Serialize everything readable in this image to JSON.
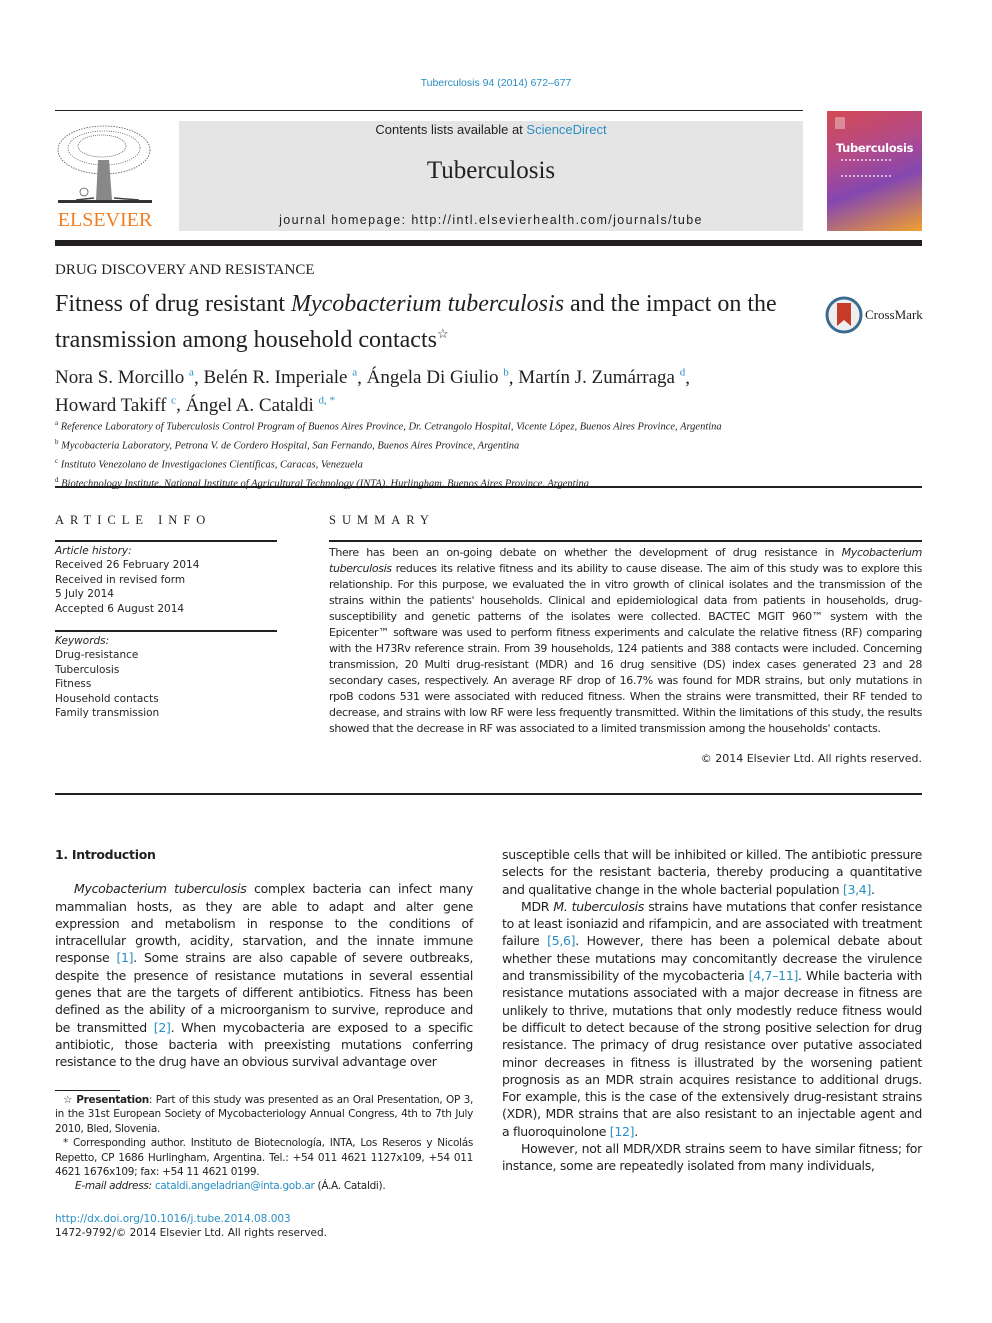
{
  "header": {
    "journal_ref": "Tuberculosis 94 (2014) 672–677",
    "contents_prefix": "Contents lists available at ",
    "contents_link": "ScienceDirect",
    "journal_name": "Tuberculosis",
    "homepage": "journal homepage: http://intl.elsevierhealth.com/journals/tube",
    "publisher_logo_text": "ELSEVIER",
    "cover_title": "Tuberculosis",
    "crossmark_label": "CrossMark"
  },
  "colors": {
    "link": "#2a8ec4",
    "elsevier_orange": "#f47d20",
    "masthead_bg": "#e5e5e5"
  },
  "article": {
    "section": "DRUG DISCOVERY AND RESISTANCE",
    "title_part1": "Fitness of drug resistant ",
    "title_italic": "Mycobacterium tuberculosis",
    "title_part2": " and the impact on the transmission among household contacts",
    "title_mark": "☆",
    "authors": [
      {
        "name": "Nora S. Morcillo",
        "sup": "a"
      },
      {
        "name": "Belén R. Imperiale",
        "sup": "a"
      },
      {
        "name": "Ángela Di Giulio",
        "sup": "b"
      },
      {
        "name": "Martín J. Zumárraga",
        "sup": "d"
      },
      {
        "name": "Howard Takiff",
        "sup": "c"
      },
      {
        "name": "Ángel A. Cataldi",
        "sup": "d, *"
      }
    ],
    "affiliations": [
      {
        "sup": "a",
        "text": "Reference Laboratory of Tuberculosis Control Program of Buenos Aires Province, Dr. Cetrangolo Hospital, Vicente López, Buenos Aires Province, Argentina"
      },
      {
        "sup": "b",
        "text": "Mycobacteria Laboratory, Petrona V. de Cordero Hospital, San Fernando, Buenos Aires Province, Argentina"
      },
      {
        "sup": "c",
        "text": "Instituto Venezolano de Investigaciones Científicas, Caracas, Venezuela"
      },
      {
        "sup": "d",
        "text": "Biotechnology Institute, National Institute of Agricultural Technology (INTA), Hurlingham, Buenos Aires Province, Argentina"
      }
    ]
  },
  "article_info": {
    "heading": "ARTICLE INFO",
    "history_label": "Article history:",
    "history": [
      "Received 26 February 2014",
      "Received in revised form",
      "5 July 2014",
      "Accepted 6 August 2014"
    ],
    "keywords_label": "Keywords:",
    "keywords": [
      "Drug-resistance",
      "Tuberculosis",
      "Fitness",
      "Household contacts",
      "Family transmission"
    ]
  },
  "summary": {
    "heading": "SUMMARY",
    "lead": "There has been an on-going debate on whether the development of drug resistance in ",
    "italic": "Mycobacterium tuberculosis",
    "body": " reduces its relative fitness and its ability to cause disease. The aim of this study was to explore this relationship. For this purpose, we evaluated the in vitro growth of clinical isolates and the transmission of the strains within the patients' households. Clinical and epidemiological data from patients in households, drug-susceptibility and genetic patterns of the isolates were collected. BACTEC MGIT 960™ system with the Epicenter™ software was used to perform fitness experiments and calculate the relative fitness (RF) comparing with the H73Rv reference strain. From 39 households, 124 patients and 388 contacts were included. Concerning transmission, 20 Multi drug-resistant (MDR) and 16 drug sensitive (DS) index cases generated 23 and 28 secondary cases, respectively. An average RF drop of 16.7% was found for MDR strains, but only mutations in rpoB codons 531 were associated with reduced fitness. When the strains were transmitted, their RF tended to decrease, and strains with low RF were less frequently transmitted. Within the limitations of this study, the results showed that the decrease in RF was associated to a limited transmission among the households' contacts.",
    "copyright": "© 2014 Elsevier Ltd. All rights reserved."
  },
  "intro": {
    "heading": "1.  Introduction",
    "p1_italic": "Mycobacterium tuberculosis",
    "p1_a": " complex bacteria can infect many mammalian hosts, as they are able to adapt and alter gene expression and metabolism in response to the conditions of intracellular growth, acidity, starvation, and the innate immune response ",
    "cite1": "[1]",
    "p1_b": ". Some strains are also capable of severe outbreaks, despite the presence of resistance mutations in several essential genes that are the targets of different antibiotics. Fitness has been defined as the ability of a microorganism to survive, reproduce and be transmitted ",
    "cite2": "[2]",
    "p1_c": ". When mycobacteria are exposed to a specific antibiotic, those bacteria with preexisting mutations conferring resistance to the drug have an obvious survival advantage over susceptible cells that will be inhibited or killed. The antibiotic pressure selects for the resistant bacteria, thereby producing a quantitative and qualitative change in the whole bacterial population ",
    "cite3": "[3,4]",
    "p1_d": ".",
    "p2_a": "MDR ",
    "p2_italic": "M. tuberculosis",
    "p2_b": " strains have mutations that confer resistance to at least isoniazid and rifampicin, and are associated with treatment failure ",
    "cite4": "[5,6]",
    "p2_c": ". However, there has been a polemical debate about whether these mutations may concomitantly decrease the virulence and transmissibility of the mycobacteria ",
    "cite5": "[4,7–11]",
    "p2_d": ". While bacteria with resistance mutations associated with a major decrease in fitness are unlikely to thrive, mutations that only modestly reduce fitness would be difficult to detect because of the strong positive selection for drug resistance. The primacy of drug resistance over putative associated minor decreases in fitness is illustrated by the worsening patient prognosis as an MDR strain acquires resistance to additional drugs. For example, this is the case of the extensively drug-resistant strains (XDR), MDR strains that are also resistant to an injectable agent and a fluoroquinolone ",
    "cite6": "[12]",
    "p2_e": ".",
    "p3": "However, not all MDR/XDR strains seem to have similar fitness; for instance, some are repeatedly isolated from many individuals,"
  },
  "footnotes": {
    "star_mark": "☆",
    "presentation_label": "Presentation",
    "presentation_text": ": Part of this study was presented as an Oral Presentation, OP 3, in the 31st European Society of Mycobacteriology Annual Congress, 4th to 7th July 2010, Bled, Slovenia.",
    "corr_mark": "*",
    "corr_text": " Corresponding author. Instituto de Biotecnología, INTA, Los Reseros y Nicolás Repetto, CP 1686 Hurlingham, Argentina. Tel.: +54 011 4621 1127x109, +54 011 4621 1676x109; fax: +54 11 4621 0199.",
    "email_label": "E-mail address:",
    "email": "cataldi.angeladrian@inta.gob.ar",
    "email_owner": " (Á.A. Cataldi).",
    "doi": "http://dx.doi.org/10.1016/j.tube.2014.08.003",
    "issn": "1472-9792/© 2014 Elsevier Ltd. All rights reserved."
  }
}
